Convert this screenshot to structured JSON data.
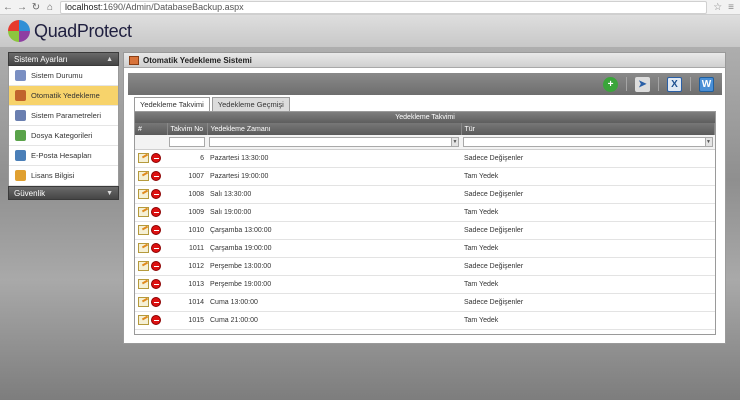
{
  "browser": {
    "url_host": "localhost",
    "url_rest": ":1690/Admin/DatabaseBackup.aspx"
  },
  "app": {
    "logo_text": "QuadProtect"
  },
  "sidebar": {
    "section_title": "Sistem Ayarları",
    "items": [
      {
        "label": "Sistem Durumu",
        "icon": "status-chart-icon",
        "color": "#7a8fc2"
      },
      {
        "label": "Otomatik Yedekleme",
        "icon": "backup-icon",
        "color": "#c0632c"
      },
      {
        "label": "Sistem Parametreleri",
        "icon": "parameters-gear-icon",
        "color": "#6a7fb0"
      },
      {
        "label": "Dosya Kategorileri",
        "icon": "file-categories-icon",
        "color": "#5aa34a"
      },
      {
        "label": "E-Posta Hesapları",
        "icon": "email-accounts-icon",
        "color": "#4a7fb8"
      },
      {
        "label": "Lisans Bilgisi",
        "icon": "license-icon",
        "color": "#e0a030"
      }
    ],
    "section2_title": "Güvenlik"
  },
  "panel": {
    "title": "Otomatik Yedekleme Sistemi",
    "tabs": [
      "Yedekleme Takvimi",
      "Yedekleme Geçmişi"
    ]
  },
  "grid": {
    "caption": "Yedekleme Takvimi",
    "columns": [
      "#",
      "Takvim No",
      "Yedekleme Zamanı",
      "Tür"
    ],
    "rows": [
      {
        "no": "6",
        "time": "Pazartesi 13:30:00",
        "type": "Sadece Değişenler"
      },
      {
        "no": "1007",
        "time": "Pazartesi 19:00:00",
        "type": "Tam Yedek"
      },
      {
        "no": "1008",
        "time": "Salı 13:30:00",
        "type": "Sadece Değişenler"
      },
      {
        "no": "1009",
        "time": "Salı 19:00:00",
        "type": "Tam Yedek"
      },
      {
        "no": "1010",
        "time": "Çarşamba 13:00:00",
        "type": "Sadece Değişenler"
      },
      {
        "no": "1011",
        "time": "Çarşamba 19:00:00",
        "type": "Tam Yedek"
      },
      {
        "no": "1012",
        "time": "Perşembe 13:00:00",
        "type": "Sadece Değişenler"
      },
      {
        "no": "1013",
        "time": "Perşembe 19:00:00",
        "type": "Tam Yedek"
      },
      {
        "no": "1014",
        "time": "Cuma 13:00:00",
        "type": "Sadece Değişenler"
      },
      {
        "no": "1015",
        "time": "Cuma 21:00:00",
        "type": "Tam Yedek"
      }
    ]
  },
  "colors": {
    "active_item": "#f7d36b",
    "add_button": "#3aa53a",
    "toolbar_icon_blue": "#2a5fa6"
  }
}
